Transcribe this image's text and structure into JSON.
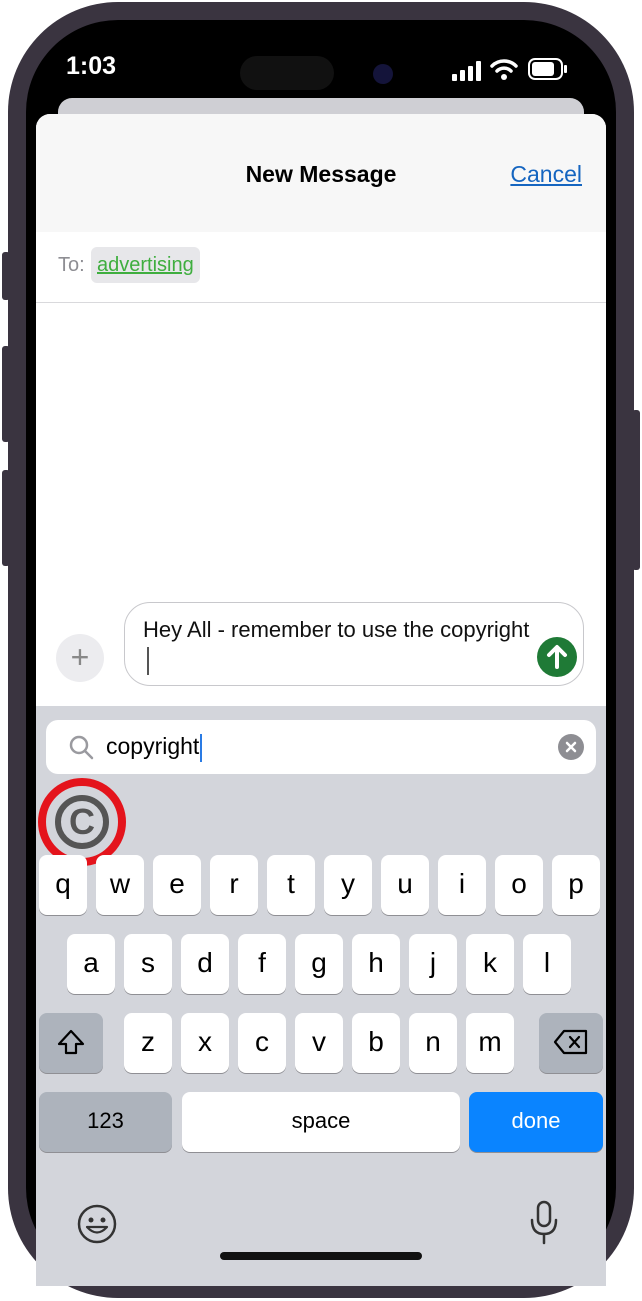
{
  "status": {
    "time": "1:03"
  },
  "nav": {
    "title": "New Message",
    "cancel": "Cancel"
  },
  "to": {
    "label": "To:",
    "recipient": "advertising"
  },
  "composer": {
    "text": "Hey All - remember to use the copyright"
  },
  "emoji_search": {
    "query": "copyright",
    "result_symbol": "©"
  },
  "keyboard": {
    "row1": [
      "q",
      "w",
      "e",
      "r",
      "t",
      "y",
      "u",
      "i",
      "o",
      "p"
    ],
    "row2": [
      "a",
      "s",
      "d",
      "f",
      "g",
      "h",
      "j",
      "k",
      "l"
    ],
    "row3": [
      "z",
      "x",
      "c",
      "v",
      "b",
      "n",
      "m"
    ],
    "numbers": "123",
    "space": "space",
    "done": "done"
  },
  "colors": {
    "accent": "#0a84ff",
    "send": "#1f7a36",
    "highlight_ring": "#e4141c",
    "recipient": "#3fae3f"
  },
  "icons": [
    "signal-icon",
    "wifi-icon",
    "battery-icon",
    "plus-icon",
    "send-arrow-icon",
    "search-icon",
    "clear-icon",
    "shift-icon",
    "backspace-icon",
    "emoji-icon",
    "microphone-icon"
  ]
}
